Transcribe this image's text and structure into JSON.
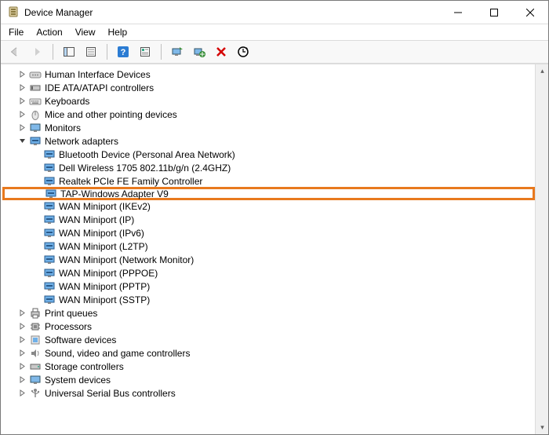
{
  "window": {
    "title": "Device Manager"
  },
  "menu": {
    "file": "File",
    "action": "Action",
    "view": "View",
    "help": "Help"
  },
  "tree": {
    "cat0": "Human Interface Devices",
    "cat1": "IDE ATA/ATAPI controllers",
    "cat2": "Keyboards",
    "cat3": "Mice and other pointing devices",
    "cat4": "Monitors",
    "cat5": "Network adapters",
    "net0": "Bluetooth Device (Personal Area Network)",
    "net1": "Dell Wireless 1705 802.11b/g/n (2.4GHZ)",
    "net2": "Realtek PCIe FE Family Controller",
    "net3": "TAP-Windows Adapter V9",
    "net4": "WAN Miniport (IKEv2)",
    "net5": "WAN Miniport (IP)",
    "net6": "WAN Miniport (IPv6)",
    "net7": "WAN Miniport (L2TP)",
    "net8": "WAN Miniport (Network Monitor)",
    "net9": "WAN Miniport (PPPOE)",
    "net10": "WAN Miniport (PPTP)",
    "net11": "WAN Miniport (SSTP)",
    "cat6": "Print queues",
    "cat7": "Processors",
    "cat8": "Software devices",
    "cat9": "Sound, video and game controllers",
    "cat10": "Storage controllers",
    "cat11": "System devices",
    "cat12": "Universal Serial Bus controllers"
  }
}
